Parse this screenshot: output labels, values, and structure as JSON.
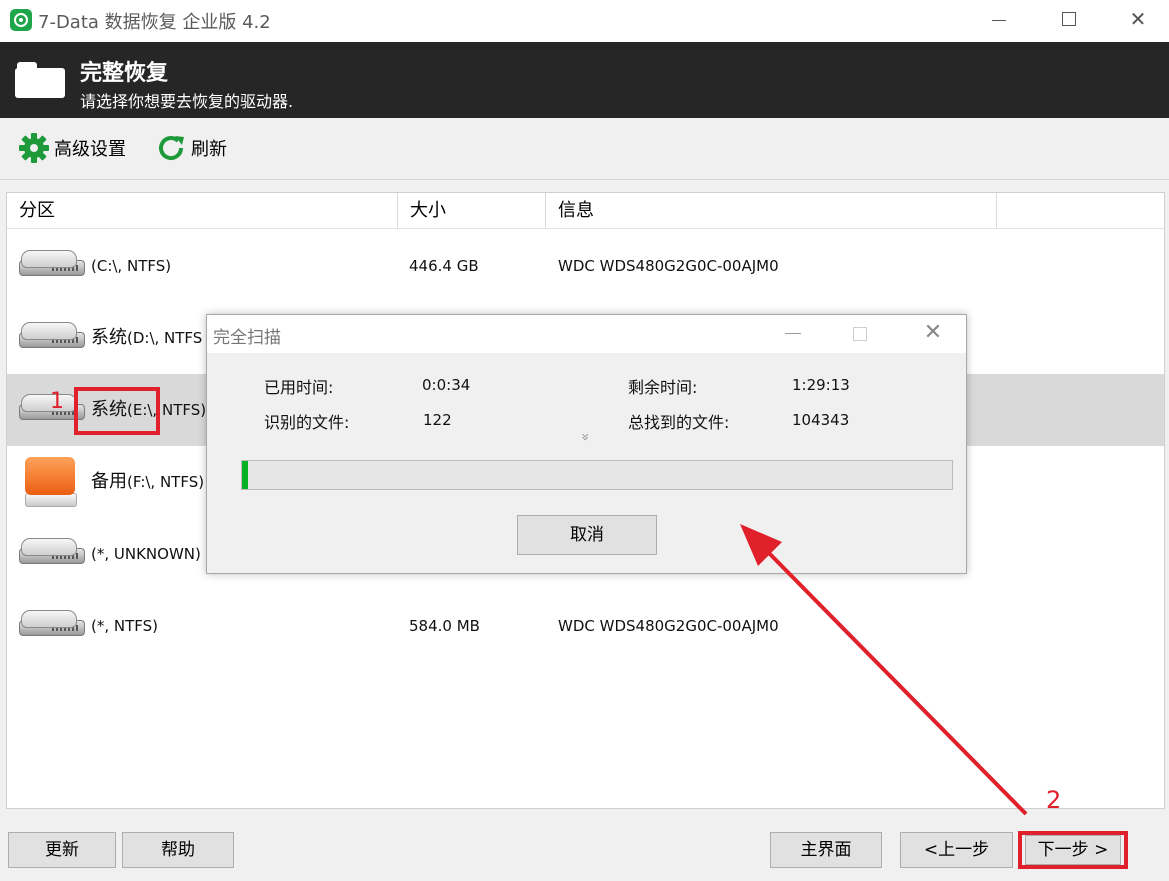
{
  "window": {
    "title": "7-Data 数据恢复 企业版 4.2",
    "minimize_label": "—",
    "close_label": "✕"
  },
  "header": {
    "title": "完整恢复",
    "subtitle": "请选择你想要去恢复的驱动器."
  },
  "toolbar": {
    "settings_label": "高级设置",
    "refresh_label": "刷新"
  },
  "table": {
    "columns": [
      "分区",
      "大小",
      "信息"
    ],
    "rows": [
      {
        "prefix": "",
        "name": "(C:\\, NTFS)",
        "size": "446.4 GB",
        "info": "WDC WDS480G2G0C-00AJM0",
        "icon": "hard-drive-icon"
      },
      {
        "prefix": "系统",
        "name": "(D:\\, NTFS",
        "size": "",
        "info": "",
        "icon": "hard-drive-icon"
      },
      {
        "prefix": "系统",
        "name": "(E:\\, NTFS)",
        "size": "",
        "info": "",
        "icon": "hard-drive-icon",
        "selected": true
      },
      {
        "prefix": "备用",
        "name": "(F:\\, NTFS)",
        "size": "",
        "info": "",
        "icon": "usb-drive-icon"
      },
      {
        "prefix": "",
        "name": "(*, UNKNOWN)",
        "size": "",
        "info": "",
        "icon": "hard-drive-icon"
      },
      {
        "prefix": "",
        "name": "(*, NTFS)",
        "size": "584.0 MB",
        "info": "WDC WDS480G2G0C-00AJM0",
        "icon": "hard-drive-icon"
      }
    ]
  },
  "scan_dialog": {
    "title": "完全扫描",
    "elapsed_label": "已用时间:",
    "elapsed_value": "0:0:34",
    "remaining_label": "剩余时间:",
    "remaining_value": "1:29:13",
    "identified_label": "识别的文件:",
    "identified_value": "122",
    "total_label": "总找到的文件:",
    "total_value": "104343",
    "expand_glyph": "»",
    "progress_fraction": 0.008,
    "cancel_label": "取消"
  },
  "annotations": {
    "step1": "1",
    "step2": "2",
    "color": "#e0202a"
  },
  "buttons": {
    "update": "更新",
    "help": "帮助",
    "main": "主界面",
    "prev": "<上一步",
    "next": "下一步 >"
  }
}
